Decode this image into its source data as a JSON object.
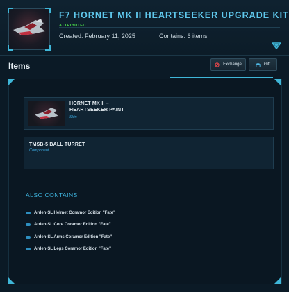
{
  "header": {
    "title": "F7 HORNET MK II HEARTSEEKER UPGRADE KIT",
    "attribution": "ATTRIBUTED",
    "created": "Created: February 11, 2025",
    "contains": "Contains: 6 items"
  },
  "items_section": {
    "label": "Items",
    "exchange_label": "Exchange",
    "gift_label": "Gift"
  },
  "items": [
    {
      "name_line1": "HORNET MK II –",
      "name_line2": "HEARTSEEKER PAINT",
      "type": "Skin"
    },
    {
      "name_line1": "TMSB-5 BALL TURRET",
      "type": "Component"
    }
  ],
  "also_contains": {
    "title": "ALSO CONTAINS",
    "items": [
      "Arden-SL Helmet Coramor Edition \"Fate\"",
      "Arden-SL Core Coramor Edition \"Fate\"",
      "Arden-SL Arms Coramor Edition \"Fate\"",
      "Arden-SL Legs Coramor Edition \"Fate\""
    ]
  },
  "icons": {
    "expand": "chevron-down-icon",
    "exchange": "exchange-icon",
    "gift": "gift-icon",
    "bullet": "pill-bullet-icon"
  },
  "colors": {
    "accent": "#3fb6d8",
    "title": "#5fc8ec",
    "attributed": "#49d84a",
    "exchange_icon": "#e0454a",
    "background": "#0b1a26"
  }
}
